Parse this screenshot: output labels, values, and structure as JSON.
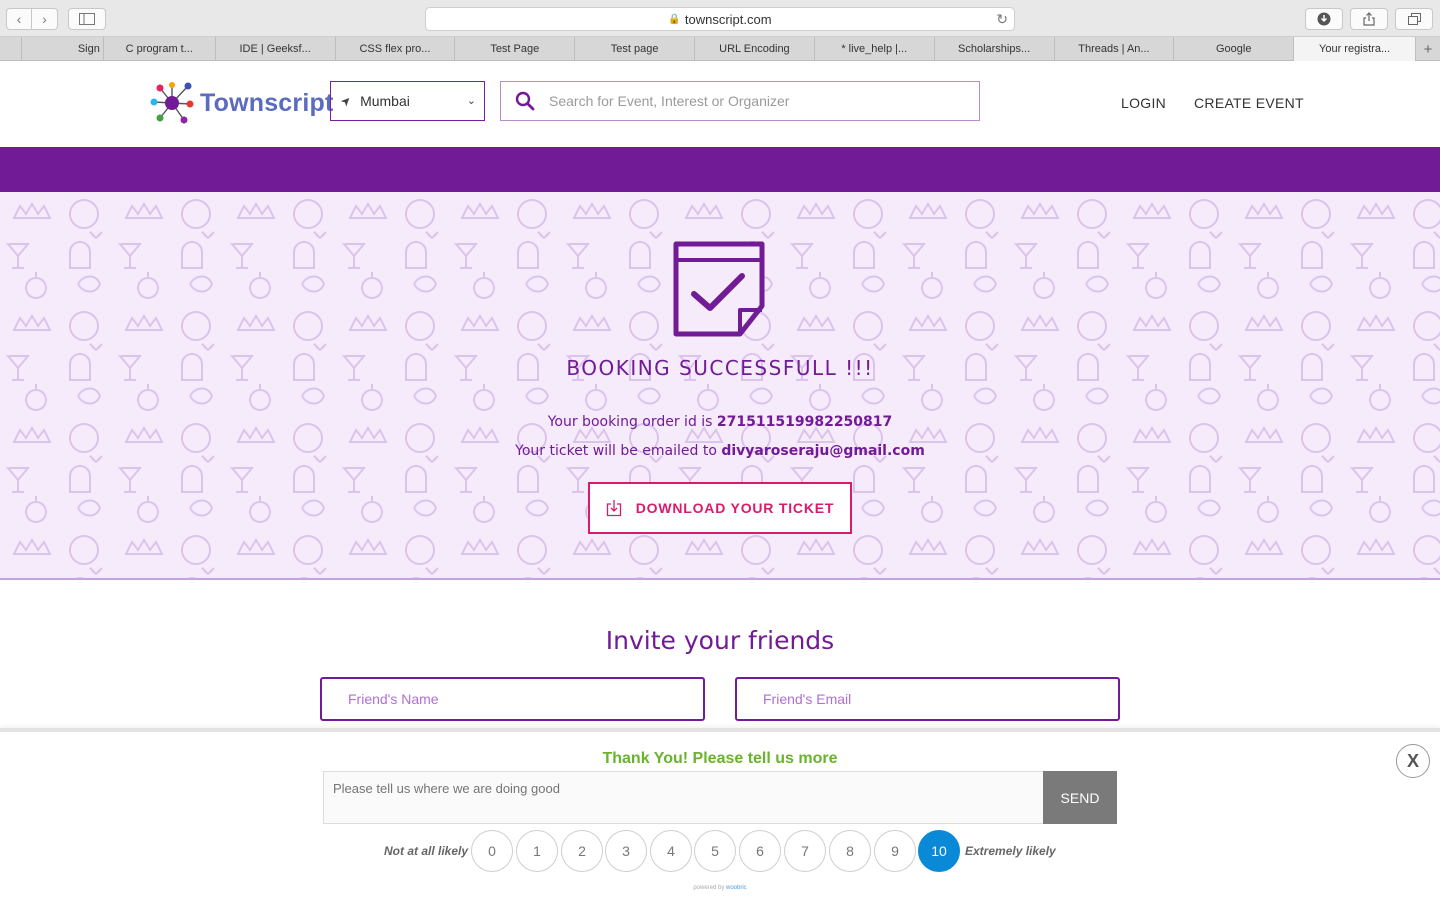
{
  "browser": {
    "url": "townscript.com",
    "tabs": [
      "",
      "Sign",
      "C program t...",
      "IDE | Geeksf...",
      "CSS flex pro...",
      "Test Page",
      "Test page",
      "URL Encoding",
      "* live_help |...",
      "Scholarships...",
      "Threads | An...",
      "Google",
      "Your registra..."
    ],
    "active_tab_index": 12
  },
  "header": {
    "logo_text": "Townscript",
    "city": "Mumbai",
    "search_placeholder": "Search for Event, Interest or Organizer",
    "login_label": "LOGIN",
    "create_event_label": "CREATE EVENT"
  },
  "hero": {
    "title": "BOOKING SUCCESSFULL !!!",
    "order_prefix": "Your booking order id is ",
    "order_id": "271511519982250817",
    "email_prefix": "Your ticket will be emailed to ",
    "email": "divyaroseraju@gmail.com",
    "download_label": "DOWNLOAD YOUR TICKET"
  },
  "invite": {
    "title": "Invite your friends",
    "name_placeholder": "Friend's Name",
    "email_placeholder": "Friend's Email"
  },
  "survey": {
    "title": "Thank You! Please tell us more",
    "feedback_placeholder": "Please tell us where we are doing good",
    "send_label": "SEND",
    "low_label": "Not at all likely",
    "high_label": "Extremely likely",
    "scores": [
      "0",
      "1",
      "2",
      "3",
      "4",
      "5",
      "6",
      "7",
      "8",
      "9",
      "10"
    ],
    "selected_score": "10",
    "close_label": "X",
    "powered_prefix": "powered by ",
    "powered_brand": "woobric"
  },
  "colors": {
    "brand_purple": "#711b96",
    "accent_pink": "#d81b6a",
    "survey_green": "#6ab32d",
    "selected_blue": "#0a8ad6"
  }
}
